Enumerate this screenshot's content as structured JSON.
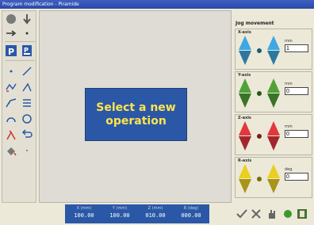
{
  "window": {
    "title": "Program modification - Piramide"
  },
  "popup": {
    "text": "Select a new\noperation"
  },
  "coordinates": [
    {
      "label": "X (mm)",
      "value": "100.00"
    },
    {
      "label": "Y (mm)",
      "value": "100.00"
    },
    {
      "label": "Z (mm)",
      "value": "010.00"
    },
    {
      "label": "R (deg)",
      "value": "000.00"
    }
  ],
  "jog": {
    "title": "Jog movement",
    "axes": [
      {
        "name": "X-axis",
        "unit": "mm",
        "value": "1",
        "color": "#3aa0d8"
      },
      {
        "name": "Y-axis",
        "unit": "mm",
        "value": "0",
        "color": "#4c9a35"
      },
      {
        "name": "Z-axis",
        "unit": "mm",
        "value": "0",
        "color": "#d8343b"
      },
      {
        "name": "R-axis",
        "unit": "deg",
        "value": "0",
        "color": "#e0c51e"
      }
    ]
  },
  "icons": {
    "toolbox": [
      "circle-tool-icon",
      "down-arrow-icon",
      "line-extend-icon",
      "p-icon",
      "program-icon",
      "point-icon",
      "line-icon",
      "polyline-icon",
      "angle-icon",
      "curve-icon",
      "hatch-icon",
      "arc-icon",
      "circle-icon",
      "lambda-icon",
      "undo-icon",
      "paint-icon"
    ],
    "bottom": [
      "check-icon",
      "cancel-icon",
      "hand-icon",
      "green-dot-icon",
      "exit-icon"
    ]
  }
}
